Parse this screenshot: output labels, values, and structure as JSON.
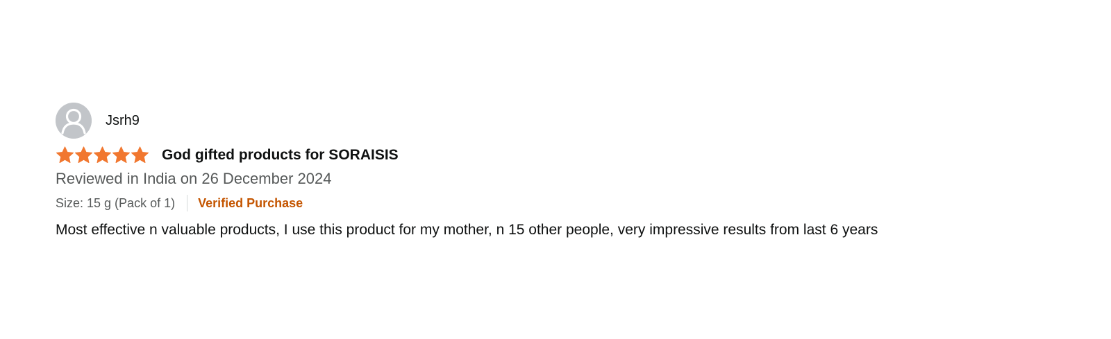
{
  "review": {
    "profile_name": "Jsrh9",
    "rating": 5,
    "rating_max": 5,
    "star_color": "#f1772f",
    "avatar_icon": "person-silhouette-icon",
    "title": "God gifted products for SORAISIS",
    "date_line": "Reviewed in India on 26 December 2024",
    "format": "Size: 15 g (Pack of 1)",
    "verified_label": "Verified Purchase",
    "verified_color": "#c45500",
    "body": "Most effective n valuable products, I use this product for my mother, n 15 other people, very impressive results from last 6 years"
  }
}
